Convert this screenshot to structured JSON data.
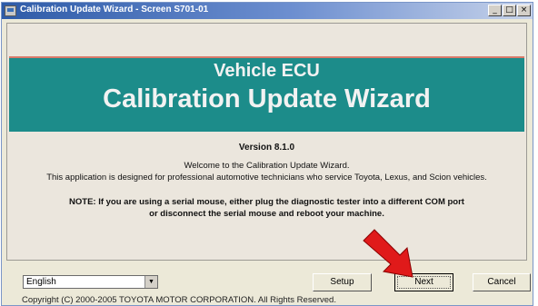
{
  "window": {
    "title": "Calibration Update Wizard - Screen S701-01",
    "controls": [
      "_",
      "□",
      "×"
    ]
  },
  "banner": {
    "subtitle": "Vehicle ECU",
    "title": "Calibration Update Wizard",
    "color": "#1c8c8a"
  },
  "content": {
    "version": "Version 8.1.0",
    "welcome": "Welcome to the Calibration Update Wizard.",
    "designed_for": "This application is designed for professional automotive technicians who service Toyota, Lexus, and Scion vehicles.",
    "note_line1": "NOTE: If you are using a serial mouse, either plug the diagnostic tester into a different COM port",
    "note_line2": "or disconnect the serial mouse and reboot your machine."
  },
  "footer": {
    "language_value": "English",
    "setup_label": "Setup",
    "next_label": "Next",
    "cancel_label": "Cancel",
    "copyright": "Copyright (C) 2000-2005 TOYOTA MOTOR CORPORATION. All Rights Reserved."
  },
  "icons": {
    "arrow": "red-pointer-arrow-icon",
    "arrow_color": "#e01a1a"
  }
}
